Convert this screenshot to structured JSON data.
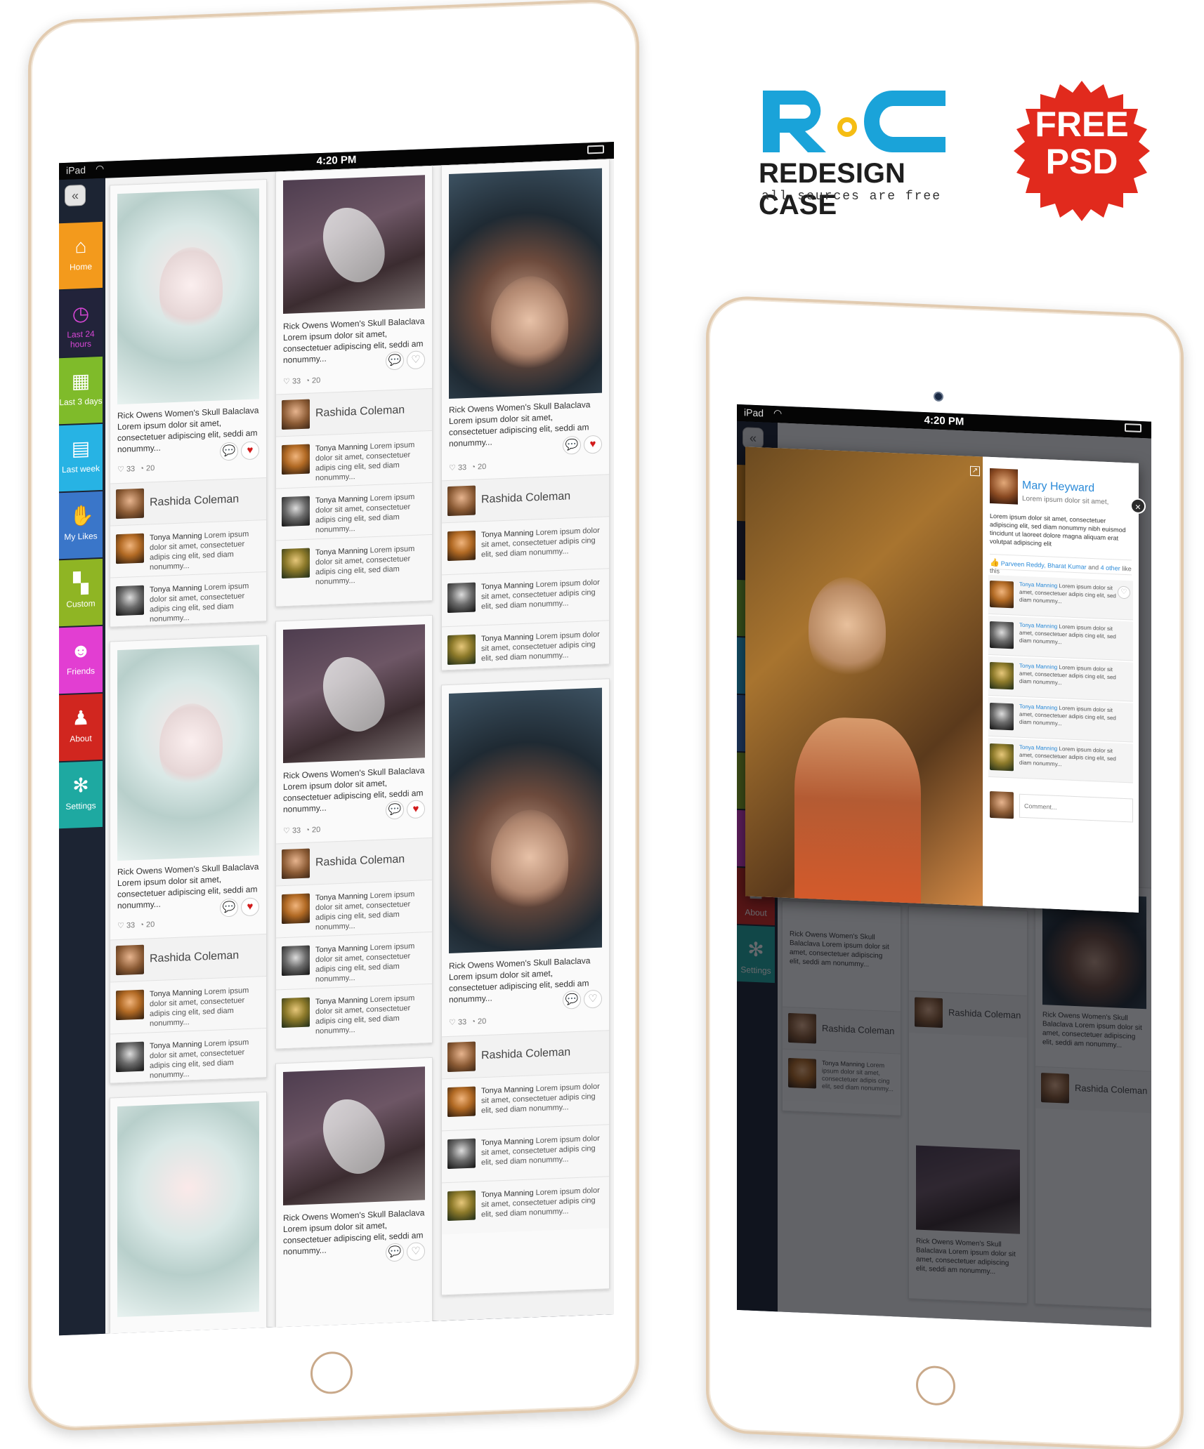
{
  "brand": {
    "name": "REDESIGN CASE",
    "tagline": "all sources are free",
    "colors": {
      "blue": "#1aa3d9",
      "yellow": "#f5bd13",
      "dark": "#1e1e1e"
    }
  },
  "badge": {
    "line1": "FREE",
    "line2": "PSD",
    "color": "#e12a1d"
  },
  "statusbar": {
    "carrier": "iPad",
    "time": "4:20 PM"
  },
  "sidebar": {
    "collapse_icon": "double-chevron-left-icon",
    "items": [
      {
        "label": "Home",
        "icon": "home-icon",
        "color": "#f39a1c"
      },
      {
        "label": "Last 24 hours",
        "icon": "clock-icon",
        "color": "#22233a"
      },
      {
        "label": "Last 3 days",
        "icon": "calendar-icon",
        "color": "#7fbb2a"
      },
      {
        "label": "Last week",
        "icon": "calendar-grid-icon",
        "color": "#27b3e4"
      },
      {
        "label": "My Likes",
        "icon": "thumbs-up-icon",
        "color": "#3a76c9"
      },
      {
        "label": "Custom",
        "icon": "grid-icon",
        "color": "#8fb524"
      },
      {
        "label": "Friends",
        "icon": "people-icon",
        "color": "#e23ed2"
      },
      {
        "label": "About",
        "icon": "person-icon",
        "color": "#d1261f"
      },
      {
        "label": "Settings",
        "icon": "gear-icon",
        "color": "#1ea9a1"
      }
    ]
  },
  "post": {
    "description": "Rick Owens Women's Skull Balaclava Lorem ipsum dolor sit amet, consectetuer adipiscing elit, seddi am nonummy...",
    "likes": "33",
    "comments": "20",
    "author": "Rashida Coleman"
  },
  "comment": {
    "author": "Tonya Manning",
    "text": "Lorem ipsum dolor sit amet, consectetuer adipis cing elit, sed diam nonummy..."
  },
  "popup": {
    "name": "Mary Heyward",
    "subtitle": "Lorem ipsum dolor sit amet,",
    "body": "Lorem ipsum dolor sit amet, consectetuer adipiscing elit, sed diam nonummy nibh euismod tincidunt ut laoreet dolore magna aliquam erat volutpat adipiscing elit",
    "likers": "Parveen Reddy, Bharat Kumar",
    "likes_and": "and",
    "likes_others": "4 other",
    "likes_suffix": "like this",
    "comment_placeholder": "Comment...",
    "close_icon": "close-icon",
    "expand_icon": "expand-icon"
  }
}
